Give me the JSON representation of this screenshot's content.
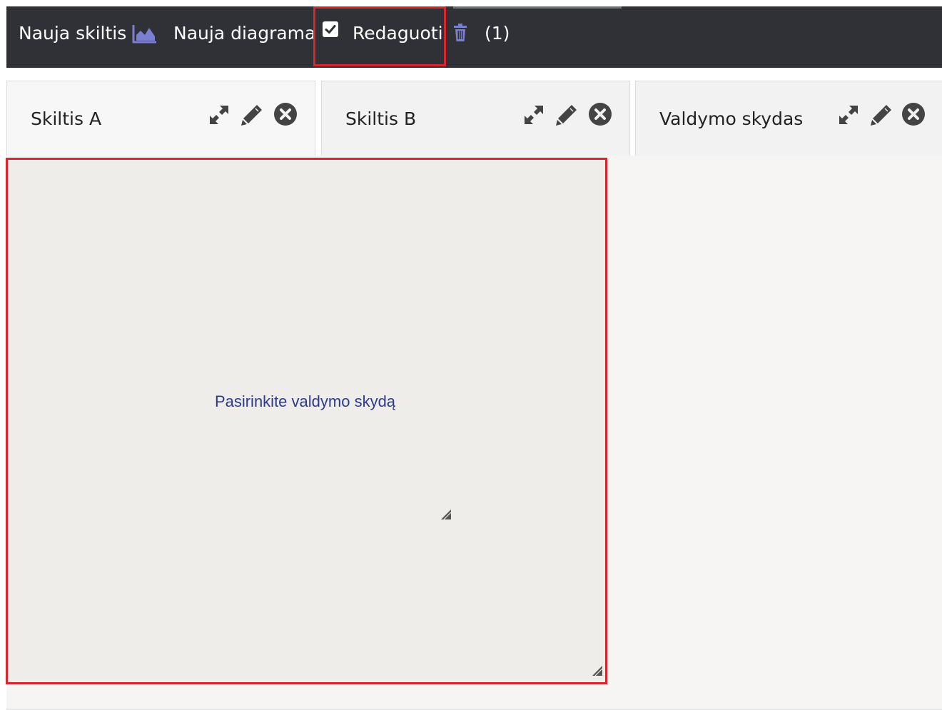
{
  "toolbar": {
    "new_section_label": "Nauja skiltis",
    "new_chart_label": "Nauja diagrama",
    "edit_label": "Redaguoti",
    "edit_checked": true,
    "trash_count": "(1)",
    "icons": {
      "chart": "area-chart-icon",
      "checkbox": "checkbox-checked-icon",
      "trash": "trash-icon"
    }
  },
  "tabs": [
    {
      "label": "Skiltis A",
      "active": true
    },
    {
      "label": "Skiltis B",
      "active": false
    },
    {
      "label": "Valdymo skydas",
      "active": false
    }
  ],
  "tab_icons": [
    "expand-icon",
    "pencil-icon",
    "close-circle-icon"
  ],
  "panel": {
    "message": "Pasirinkite valdymo skydą"
  },
  "colors": {
    "toolbar_bg": "#2f3136",
    "accent_icon": "#7b7fd1",
    "highlight": "#d9262c",
    "message_text": "#2d3a8c",
    "panel_bg": "#eeedea"
  }
}
